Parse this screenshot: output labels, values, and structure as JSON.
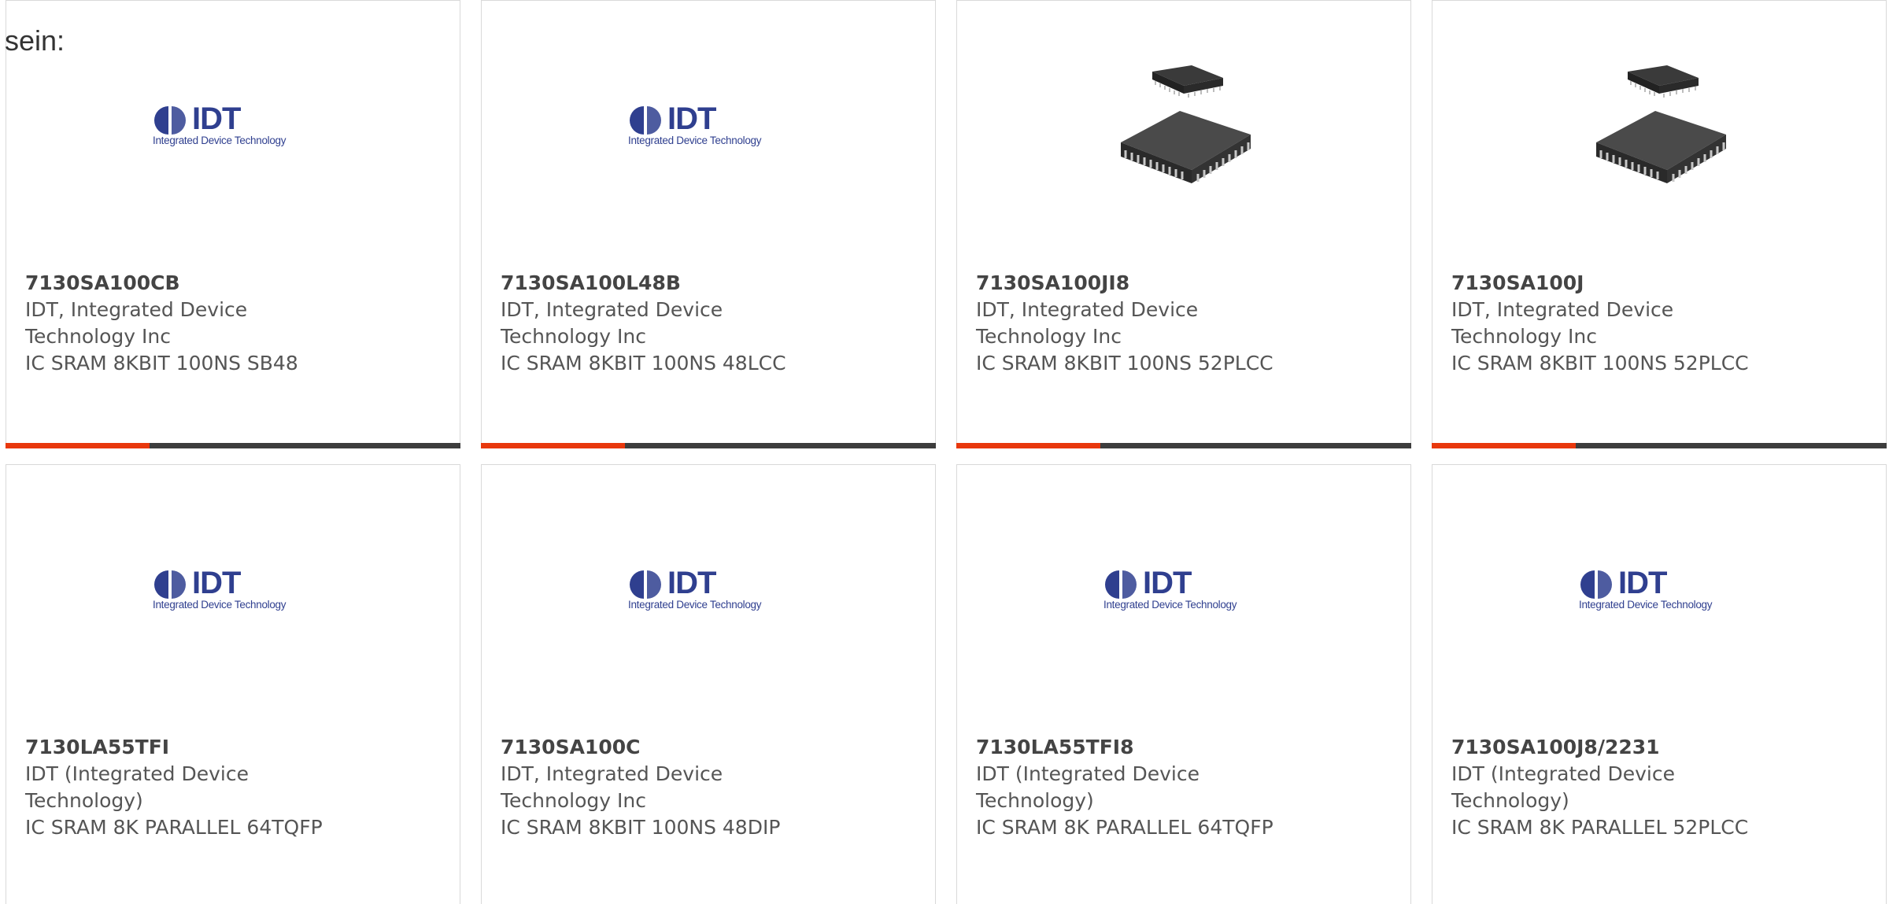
{
  "lead_text": "sein:",
  "colors": {
    "accent": "#e8380d",
    "bar": "#3d3d3d",
    "idt_blue": "#2f3f8f"
  },
  "idt_logo": {
    "word": "IDT",
    "tagline": "Integrated Device Technology"
  },
  "cards": [
    {
      "image": "idt-logo",
      "part": "7130SA100CB",
      "mfr": "IDT, Integrated Device Technology Inc",
      "desc": "IC SRAM 8KBIT 100NS SB48"
    },
    {
      "image": "idt-logo",
      "part": "7130SA100L48B",
      "mfr": "IDT, Integrated Device Technology Inc",
      "desc": "IC SRAM 8KBIT 100NS 48LCC"
    },
    {
      "image": "plcc-chip",
      "part": "7130SA100JI8",
      "mfr": "IDT, Integrated Device Technology Inc",
      "desc": "IC SRAM 8KBIT 100NS 52PLCC"
    },
    {
      "image": "plcc-chip",
      "part": "7130SA100J",
      "mfr": "IDT, Integrated Device Technology Inc",
      "desc": "IC SRAM 8KBIT 100NS 52PLCC"
    },
    {
      "image": "idt-logo",
      "part": "7130LA55TFI",
      "mfr": "IDT (Integrated Device Technology)",
      "desc": "IC SRAM 8K PARALLEL 64TQFP"
    },
    {
      "image": "idt-logo",
      "part": "7130SA100C",
      "mfr": "IDT, Integrated Device Technology Inc",
      "desc": "IC SRAM 8KBIT 100NS 48DIP"
    },
    {
      "image": "idt-logo",
      "part": "7130LA55TFI8",
      "mfr": "IDT (Integrated Device Technology)",
      "desc": "IC SRAM 8K PARALLEL 64TQFP"
    },
    {
      "image": "idt-logo",
      "part": "7130SA100J8/2231",
      "mfr": "IDT (Integrated Device Technology)",
      "desc": "IC SRAM 8K PARALLEL 52PLCC"
    }
  ]
}
